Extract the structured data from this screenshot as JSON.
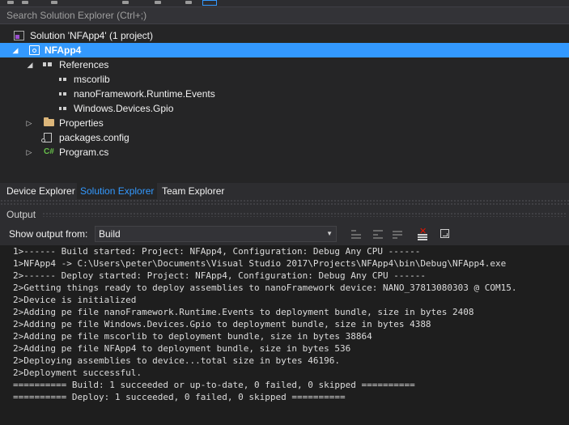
{
  "search": {
    "placeholder": "Search Solution Explorer (Ctrl+;)"
  },
  "tree": {
    "solution": "Solution 'NFApp4' (1 project)",
    "project": "NFApp4",
    "references": "References",
    "refs": [
      "mscorlib",
      "nanoFramework.Runtime.Events",
      "Windows.Devices.Gpio"
    ],
    "properties": "Properties",
    "packages_config": "packages.config",
    "program_cs": "Program.cs",
    "cs_icon_text": "C#",
    "expander_expanded": "◢",
    "expander_collapsed": "▷"
  },
  "tabs": [
    "Device Explorer",
    "Solution Explorer",
    "Team Explorer"
  ],
  "active_tab": "Solution Explorer",
  "output": {
    "title": "Output",
    "show_from_label": "Show output from:",
    "show_from_value": "Build",
    "dropdown_arrow": "▼",
    "lines": [
      "1>------ Build started: Project: NFApp4, Configuration: Debug Any CPU ------",
      "1>NFApp4 -> C:\\Users\\peter\\Documents\\Visual Studio 2017\\Projects\\NFApp4\\bin\\Debug\\NFApp4.exe",
      "2>------ Deploy started: Project: NFApp4, Configuration: Debug Any CPU ------",
      "2>Getting things ready to deploy assemblies to nanoFramework device: NANO_37813080303 @ COM15.",
      "2>Device is initialized",
      "2>Adding pe file nanoFramework.Runtime.Events to deployment bundle, size in bytes 2408",
      "2>Adding pe file Windows.Devices.Gpio to deployment bundle, size in bytes 4388",
      "2>Adding pe file mscorlib to deployment bundle, size in bytes 38864",
      "2>Adding pe file NFApp4 to deployment bundle, size in bytes 536",
      "2>Deploying assemblies to device...total size in bytes 46196.",
      "2>Deployment successful.",
      "========== Build: 1 succeeded or up-to-date, 0 failed, 0 skipped ==========",
      "========== Deploy: 1 succeeded, 0 failed, 0 skipped =========="
    ]
  },
  "colors": {
    "background": "#252526",
    "selection": "#3399ff",
    "active_tab_text": "#3399ff",
    "output_background": "#1e1e1e",
    "csharp_icon": "#68c14b",
    "folder_icon": "#dcb67a",
    "clear_icon": "#e51400"
  }
}
